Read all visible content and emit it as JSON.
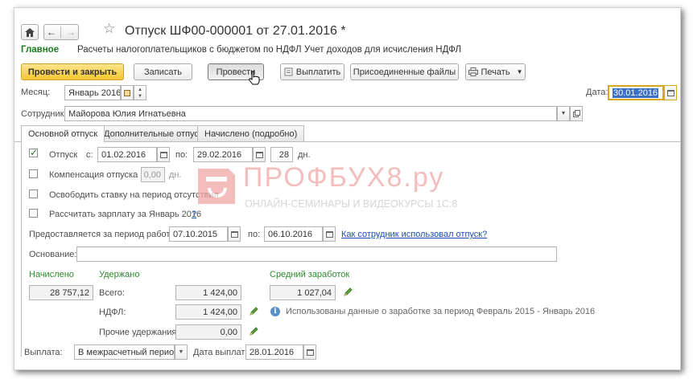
{
  "window": {
    "title": "Отпуск ШФ00-000001 от 27.01.2016 *"
  },
  "nav": {
    "home": "Главное",
    "payments": "Расчеты налогоплательщиков с бюджетом по НДФЛ",
    "income": "Учет доходов для исчисления НДФЛ"
  },
  "toolbar": {
    "post_close": "Провести и закрыть",
    "save": "Записать",
    "post": "Провести",
    "pay": "Выплатить",
    "attached": "Присоединенные файлы",
    "print": "Печать"
  },
  "header": {
    "month_label": "Месяц:",
    "month_value": "Январь 2016",
    "date_label": "Дата:",
    "date_value": "30.01.2016",
    "employee_label": "Сотрудник:",
    "employee_value": "Майорова Юлия Игнатьевна"
  },
  "tabs": [
    "Основной отпуск",
    "Дополнительные отпуска",
    "Начислено (подробно)"
  ],
  "vacation": {
    "label": "Отпуск",
    "from_label": "с:",
    "from": "01.02.2016",
    "to_label": "по:",
    "to": "29.02.2016",
    "days": "28",
    "days_unit": "дн.",
    "checked": true
  },
  "compensation": {
    "label": "Компенсация отпуска",
    "value": "0,00",
    "unit": "дн."
  },
  "release_rate": {
    "label": "Освободить ставку на период отсутствия"
  },
  "recalc": {
    "label": "Рассчитать зарплату за Январь 2016",
    "help": "?"
  },
  "work_period": {
    "label": "Предоставляется за период работы с:",
    "from": "07.10.2015",
    "to_label": "по:",
    "to": "06.10.2016",
    "link": "Как сотрудник использовал отпуск?"
  },
  "basis": {
    "label": "Основание:",
    "value": ""
  },
  "totals": {
    "accrued_label": "Начислено",
    "accrued_value": "28 757,12",
    "withheld_label": "Удержано",
    "total_label": "Всего:",
    "total_value": "1 424,00",
    "ndfl_label": "НДФЛ:",
    "ndfl_value": "1 424,00",
    "other_label": "Прочие удержания:",
    "other_value": "0,00",
    "avg_label": "Средний заработок",
    "avg_value": "1 027,04",
    "info_text": "Использованы данные о заработке за период Февраль 2015 - Январь 2016"
  },
  "payment": {
    "label": "Выплата:",
    "value": "В межрасчетный период",
    "date_label": "Дата выплаты:",
    "date_value": "28.01.2016"
  },
  "watermark": {
    "brand": "ПРОФБУХ8.ру",
    "subtitle": "ОНЛАЙН-СЕМИНАРЫ И ВИДЕОКУРСЫ 1С:8"
  },
  "colors": {
    "accent_primary": "#f5c732",
    "section_green": "#2e8b2e",
    "link": "#1a4fb3",
    "watermark": "#e88a8a"
  }
}
